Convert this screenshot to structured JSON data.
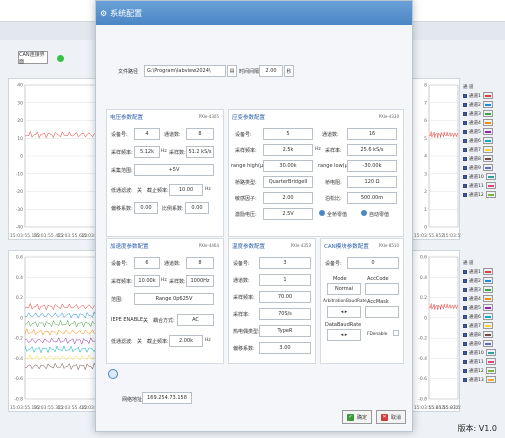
{
  "background": {
    "camera_button": "CAN连接界面",
    "channel_label": "通道",
    "left_upper_ticks": [
      "15:03:55.192",
      "15:03:55.412",
      "15:03:55.632",
      "15:03:55.852"
    ],
    "left_upper_yticks": [
      "40",
      "30",
      "20",
      "10",
      "0",
      "-10",
      "-20",
      "-30",
      "-40"
    ],
    "left_lower_ticks": [
      "15:03:55.192",
      "15:03:55.312",
      "15:03:55.432",
      "15:03:55.552"
    ],
    "left_lower_yticks": [
      "0.6",
      "0.4",
      "0.2",
      "0",
      "-0.2",
      "-0.4",
      "-0.6",
      "-0.8"
    ],
    "left_ylabel": "测试量",
    "right_upper_ticks": [
      "15:03:55.852",
      "15:03:55.882"
    ],
    "right_lower_ticks": [
      "15:03:55.852",
      "15:03:55.872",
      "15:03:55.892"
    ],
    "right_upper_yticks": [
      "8",
      "7",
      "6",
      "5",
      "4",
      "3",
      "2",
      "1",
      "0"
    ],
    "legend_upper": [
      "通道1",
      "通道2",
      "通道3",
      "通道4",
      "通道5",
      "通道6",
      "通道7",
      "通道8",
      "通道9",
      "通道10",
      "通道11",
      "通道12"
    ],
    "legend_lower": [
      "通道1",
      "通道2",
      "通道3",
      "通道4",
      "通道5",
      "通道6",
      "通道7",
      "通道8",
      "通道9",
      "通道10",
      "通道11",
      "通道12",
      "通道13"
    ],
    "legend_hdr": "通 道",
    "version": "版本: V1.0"
  },
  "dialog": {
    "title": "系统配置",
    "file_path_label": "文件路径",
    "file_path_value": "G:\\Program\\labview2024\\",
    "browse_icon": "folder-icon",
    "time_interval_label": "时间间隔",
    "time_interval_value": "2.00",
    "time_interval_unit": "秒",
    "ip_label": "网络地址:",
    "ip_value": "169.254.73.158",
    "ok_label": "确定",
    "cancel_label": "取消"
  },
  "sections": {
    "voltage": {
      "title": "电压参数配置",
      "id": "PXIe-4305",
      "device_label": "设备号:",
      "device_value": "4",
      "channels_label": "通道数:",
      "channels_value": "8",
      "rate_label": "采样频率:",
      "rate_value": "5.12k",
      "rate_unit": "Hz",
      "samples_label": "采样数:",
      "samples_value": "51.2 kS/s",
      "range_label": "采集范围:",
      "range_value": "+5V",
      "lowpass_label": "低通滤波:",
      "lowpass_switch": "关",
      "cutoff_label": "截止频率:",
      "cutoff_value": "10.00",
      "cutoff_unit": "Hz",
      "calib_label": "偏移系数:",
      "calib_value": "0.00",
      "calib2_label": "比例系数:",
      "calib2_value": "0.00"
    },
    "strain": {
      "title": "应变参数配置",
      "id": "PXIe-4330",
      "device_label": "设备号:",
      "device_value": "5",
      "channels_label": "通道数:",
      "channels_value": "16",
      "rate_label": "采样频率:",
      "rate_value": "2.5k",
      "rate_unit": "Hz",
      "samples_label": "采样率:",
      "samples_value": "25.6 kS/s",
      "gauge_label": "range high(με)",
      "gauge_value": "30.00k",
      "gauge2_label": "range low(με)",
      "gauge2_value": "-30.00k",
      "bridge_label": "桥路类型:",
      "bridge_value": "QuarterBridgeII",
      "resist_label": "桥电阻:",
      "resist_value": "120 Ω",
      "gf_label": "敏感因子:",
      "gf_value": "2.00",
      "poisson_label": "泊松比:",
      "poisson_value": "500.00m",
      "exc_label": "激励电压:",
      "exc_value": "2.5V",
      "radio1_label": "全桥零值",
      "radio2_label": "自动零值"
    },
    "accel": {
      "title": "加速度参数配置",
      "id": "PXIe-4464",
      "device_label": "设备号:",
      "device_value": "6",
      "channels_label": "通道数:",
      "channels_value": "8",
      "rate_label": "采样频率:",
      "rate_value": "10.00k",
      "rate_unit": "Hz",
      "samples_label": "采样数:",
      "samples_value": "1000Hz",
      "range_label": "范围:",
      "range_value": "Range 0p625V",
      "iepe_label": "IEPE ENABLE",
      "iepe_switch": "关",
      "coupling_label": "耦合方式:",
      "coupling_value": "AC",
      "lowpass_label": "低通滤波:",
      "lowpass_switch": "关",
      "cutoff_label": "截止频率:",
      "cutoff_value": "2.00k",
      "cutoff_unit": "Hz"
    },
    "temp": {
      "title": "温度参数配置",
      "id": "PXIe-4353",
      "device_label": "设备号:",
      "device_value": "3",
      "channels_label": "通道数:",
      "channels_value": "1",
      "rate_label": "采样频率:",
      "rate_value": "70.00",
      "samples_label": "采样率:",
      "samples_value": "70S/s",
      "tc_label": "热电偶类型:",
      "tc_value": "TypeR",
      "cjc_label": "偏移系数:",
      "cjc_value": "3.00"
    },
    "can": {
      "title": "CAN模块参数配置",
      "id": "PXIe-8510",
      "device_label": "设备号:",
      "device_value": "0",
      "mode_label": "Mode",
      "mode_value": "Normal",
      "ackcode_label": "AccCode",
      "arb_label": "ArbitrationBaudRate",
      "accmask_label": "AccMask",
      "data_label": "DataBaudRate",
      "fd_label": "FDenable"
    }
  },
  "colors": {
    "title_bar": "#5a94cf",
    "accent": "#2b5fa8",
    "status_green": "#35c24a"
  }
}
